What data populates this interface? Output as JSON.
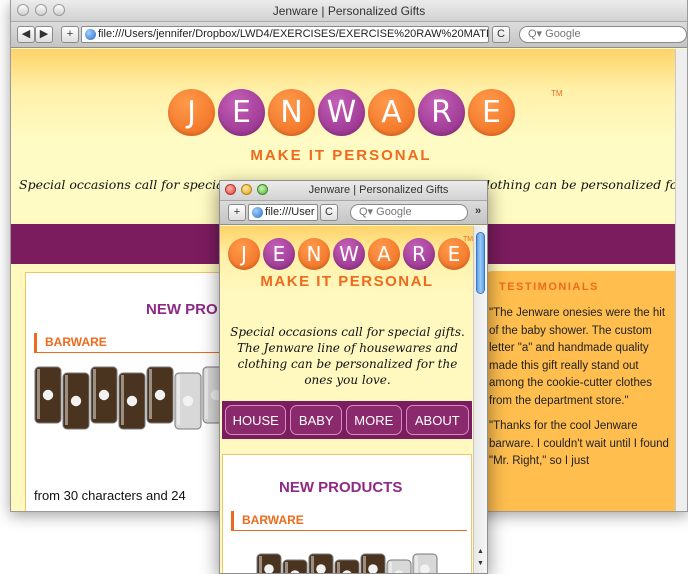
{
  "back_window": {
    "title": "Jenware | Personalized Gifts",
    "nav_back": "◀",
    "nav_forward": "▶",
    "add_tab": "+",
    "url": "file:///Users/jennifer/Dropbox/LWD4/EXERCISES/EXERCISE%20RAW%20MATE",
    "reload": "C",
    "search_placeholder": "Q▾ Google",
    "logo_letters": [
      "J",
      "E",
      "N",
      "W",
      "A",
      "R",
      "E"
    ],
    "trademark": "TM",
    "tagline": "MAKE IT PERSONAL",
    "intro_left": "Special occasions call for special",
    "intro_right": "lothing can be personalized for",
    "intro_mid_fragment": "gifts. The Jenware line of housewares and",
    "new_products": "NEW PRO",
    "barware": "BARWARE",
    "chars_text": "from 30 characters and 24",
    "testimonials_heading": "TESTIMONIALS",
    "testimonial_1": "\"The Jenware onesies were the hit of the baby shower. The custom letter \"a\" and handmade quality made this gift really stand out among the cookie-cutter clothes from the department store.\"",
    "testimonial_2": "\"Thanks for the cool Jenware barware. I couldn't wait until I found \"Mr. Right,\" so I just"
  },
  "front_window": {
    "title": "Jenware | Personalized Gifts",
    "add_tab": "+",
    "url": "file:///User",
    "reload": "C",
    "search_placeholder": "Q▾ Google",
    "overflow": "»",
    "logo_letters": [
      "J",
      "E",
      "N",
      "W",
      "A",
      "R",
      "E"
    ],
    "trademark": "TM",
    "tagline": "MAKE IT PERSONAL",
    "intro": "Special occasions call for special gifts. The Jenware line of housewares and clothing can be personalized for the ones you love.",
    "nav": [
      "HOUSE",
      "BABY",
      "MORE",
      "ABOUT"
    ],
    "new_products": "NEW PRODUCTS",
    "barware": "BARWARE"
  },
  "colors": {
    "orange": "#ee6a1e",
    "purple": "#8e2a86",
    "nav_bg": "#7b1c5e",
    "page_bg": "#fffbc4",
    "testimonial_bg": "#ffbe4e"
  }
}
